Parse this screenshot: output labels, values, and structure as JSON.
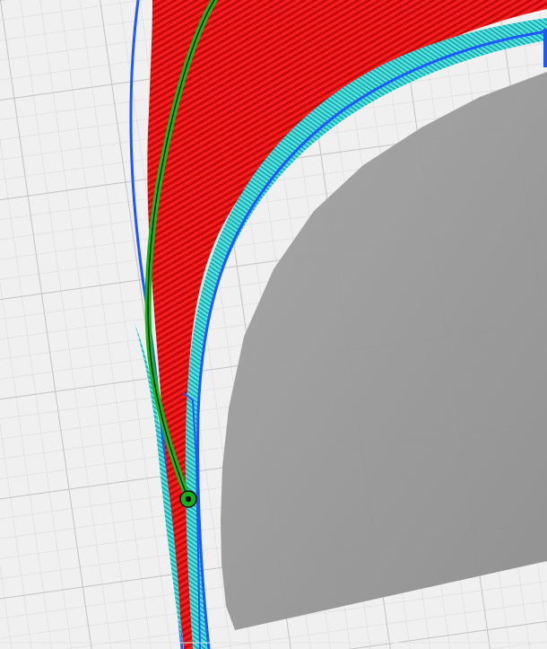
{
  "scene": {
    "type": "3d-print-slicer-toolpath-preview"
  },
  "colors": {
    "background": "#f0f0f0",
    "grid_minor": "#d6d6d6",
    "grid_major": "#bdbdbd",
    "shadow": "#8f8f8f",
    "outer_perimeter": "#1f57ff",
    "perimeter": "#ff1010",
    "infill": "#31d6d6",
    "travel_path": "#16b81b",
    "travel_path_core": "#0a0a0a",
    "travel_endpoint": "#18b11d"
  }
}
